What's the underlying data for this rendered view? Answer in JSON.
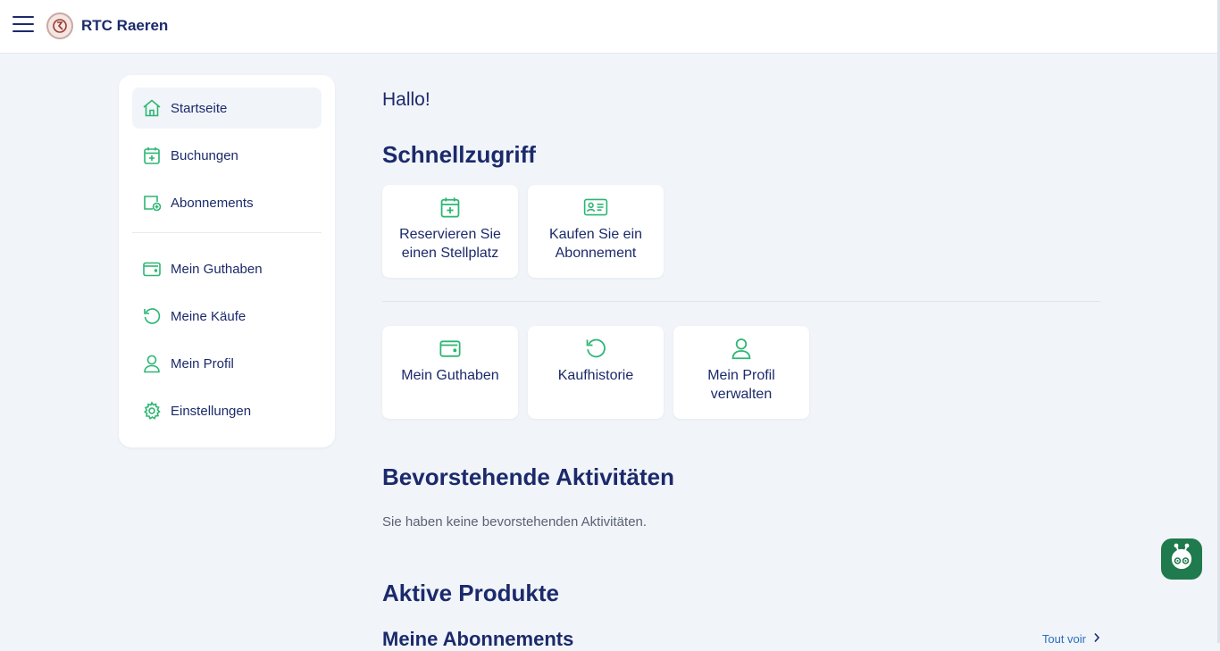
{
  "header": {
    "title": "RTC Raeren"
  },
  "sidebar": {
    "items": [
      {
        "label": "Startseite",
        "icon": "home-icon"
      },
      {
        "label": "Buchungen",
        "icon": "calendar-plus-icon"
      },
      {
        "label": "Abonnements",
        "icon": "subscription-icon"
      },
      {
        "label": "Mein Guthaben",
        "icon": "wallet-icon"
      },
      {
        "label": "Meine Käufe",
        "icon": "history-icon"
      },
      {
        "label": "Mein Profil",
        "icon": "user-icon"
      },
      {
        "label": "Einstellungen",
        "icon": "gear-icon"
      }
    ]
  },
  "main": {
    "greeting": "Hallo!",
    "quick_access": {
      "title": "Schnellzugriff",
      "cards": [
        {
          "label": "Reservieren Sie\neinen Stellplatz",
          "icon": "calendar-plus-icon"
        },
        {
          "label": "Kaufen Sie ein\nAbonnement",
          "icon": "id-card-icon"
        },
        {
          "label": "Mein Guthaben",
          "icon": "wallet-icon"
        },
        {
          "label": "Kaufhistorie",
          "icon": "history-icon"
        },
        {
          "label": "Mein Profil\nverwalten",
          "icon": "user-icon"
        }
      ]
    },
    "upcoming": {
      "title": "Bevorstehende Aktivitäten",
      "empty_text": "Sie haben keine bevorstehenden Aktivitäten."
    },
    "active_products": {
      "title": "Aktive Produkte",
      "subscriptions_title": "Meine Abonnements",
      "see_all": "Tout voir"
    }
  },
  "colors": {
    "accent": "#2bb673",
    "navy": "#1b2a6b",
    "fab": "#1f7a4d"
  }
}
